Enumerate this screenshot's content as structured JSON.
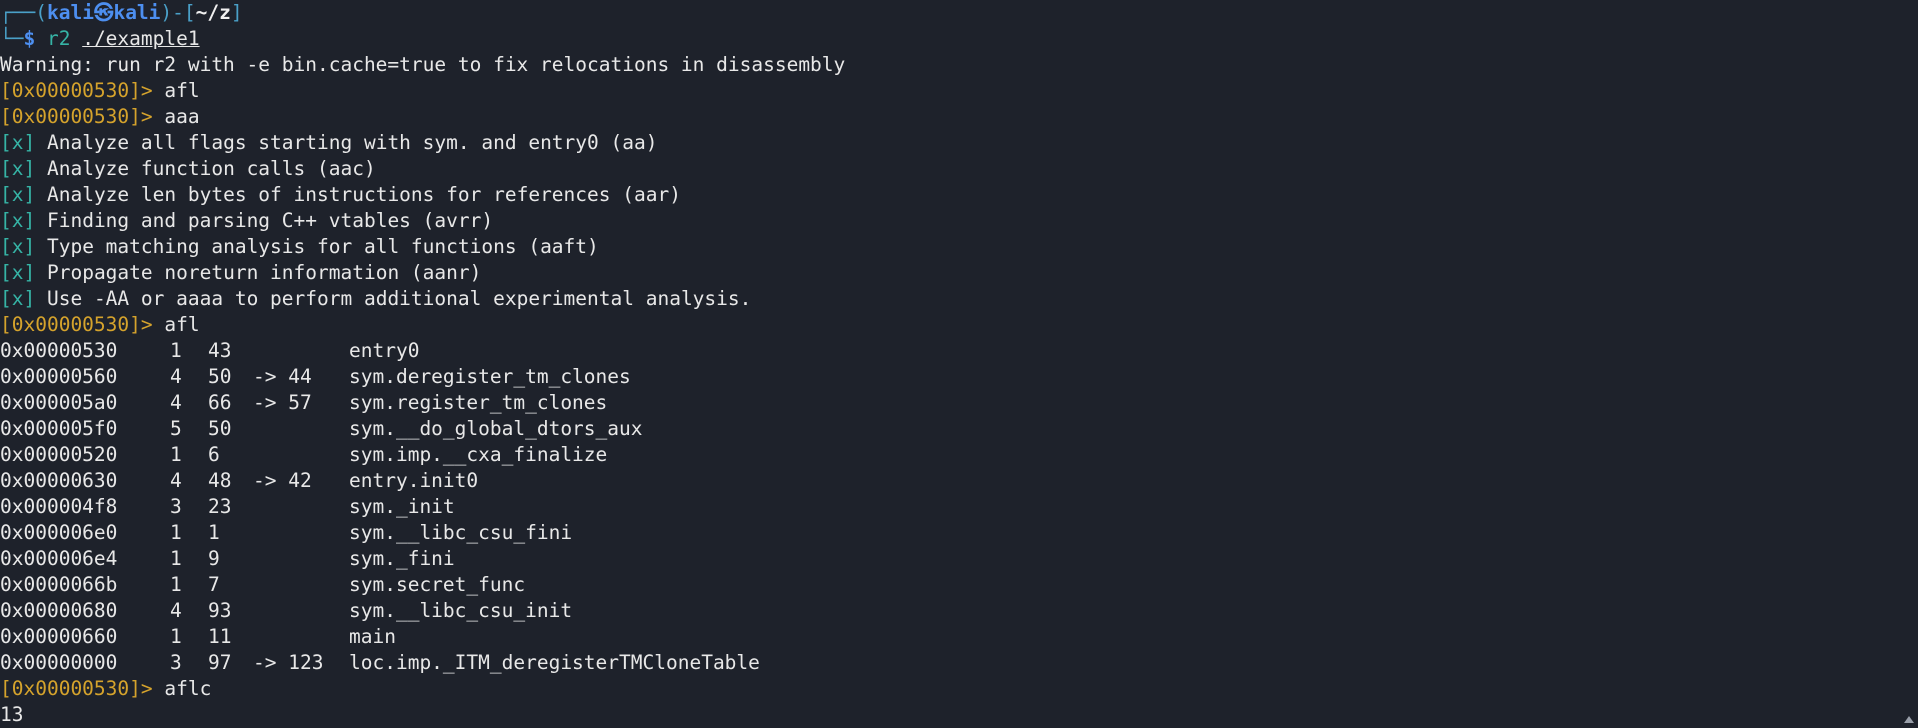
{
  "prompt": {
    "corner_top": "┌──(",
    "user": "kali",
    "at_symbol": "㉿",
    "host": "kali",
    "close_paren": ")-[",
    "cwd": "~/z",
    "close_bracket": "]",
    "corner_bottom": "└─",
    "dollar": "$ ",
    "cmd_name": "r2",
    "cmd_arg": "./example1"
  },
  "warning": "Warning: run r2 with -e bin.cache=true to fix relocations in disassembly",
  "r2_prompt": "[0x00000530]>",
  "commands": {
    "afl_1": "afl",
    "aaa": "aaa",
    "afl_2": "afl",
    "aflc": "aflc"
  },
  "analysis": [
    {
      "mark": "[x]",
      "text": "Analyze all flags starting with sym. and entry0 (aa)"
    },
    {
      "mark": "[x]",
      "text": "Analyze function calls (aac)"
    },
    {
      "mark": "[x]",
      "text": "Analyze len bytes of instructions for references (aar)"
    },
    {
      "mark": "[x]",
      "text": "Finding and parsing C++ vtables (avrr)"
    },
    {
      "mark": "[x]",
      "text": "Type matching analysis for all functions (aaft)"
    },
    {
      "mark": "[x]",
      "text": "Propagate noreturn information (aanr)"
    },
    {
      "mark": "[x]",
      "text": "Use -AA or aaaa to perform additional experimental analysis."
    }
  ],
  "functions": [
    {
      "addr": "0x00000530",
      "nbbs": "1",
      "size": "43",
      "ret": "",
      "name": "entry0"
    },
    {
      "addr": "0x00000560",
      "nbbs": "4",
      "size": "50",
      "ret": "-> 44",
      "name": "sym.deregister_tm_clones"
    },
    {
      "addr": "0x000005a0",
      "nbbs": "4",
      "size": "66",
      "ret": "-> 57",
      "name": "sym.register_tm_clones"
    },
    {
      "addr": "0x000005f0",
      "nbbs": "5",
      "size": "50",
      "ret": "",
      "name": "sym.__do_global_dtors_aux"
    },
    {
      "addr": "0x00000520",
      "nbbs": "1",
      "size": "6",
      "ret": "",
      "name": "sym.imp.__cxa_finalize"
    },
    {
      "addr": "0x00000630",
      "nbbs": "4",
      "size": "48",
      "ret": "-> 42",
      "name": "entry.init0"
    },
    {
      "addr": "0x000004f8",
      "nbbs": "3",
      "size": "23",
      "ret": "",
      "name": "sym._init"
    },
    {
      "addr": "0x000006e0",
      "nbbs": "1",
      "size": "1",
      "ret": "",
      "name": "sym.__libc_csu_fini"
    },
    {
      "addr": "0x000006e4",
      "nbbs": "1",
      "size": "9",
      "ret": "",
      "name": "sym._fini"
    },
    {
      "addr": "0x0000066b",
      "nbbs": "1",
      "size": "7",
      "ret": "",
      "name": "sym.secret_func"
    },
    {
      "addr": "0x00000680",
      "nbbs": "4",
      "size": "93",
      "ret": "",
      "name": "sym.__libc_csu_init"
    },
    {
      "addr": "0x00000660",
      "nbbs": "1",
      "size": "11",
      "ret": "",
      "name": "main"
    },
    {
      "addr": "0x00000000",
      "nbbs": "3",
      "size": "97",
      "ret": "-> 123",
      "name": "loc.imp._ITM_deregisterTMCloneTable"
    }
  ],
  "aflc_result": "13",
  "colors": {
    "background": "#1e222b",
    "prompt_blue": "#4d8ff0",
    "prompt_box": "#4aa0c8",
    "r2_prompt": "#d5a32c",
    "analysis_mark": "#36b4a6",
    "text": "#e8e8e8"
  }
}
